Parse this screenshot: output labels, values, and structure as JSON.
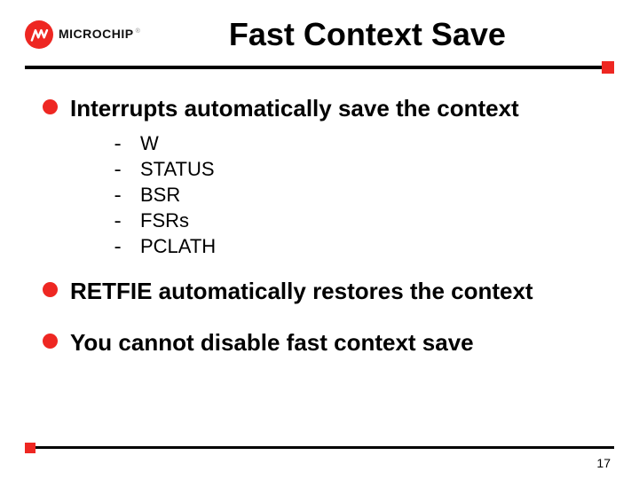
{
  "brand": {
    "name": "MICROCHIP",
    "registered": "®"
  },
  "title": "Fast Context Save",
  "bullets": [
    {
      "text": "Interrupts automatically save the context",
      "sub": [
        "W",
        "STATUS",
        "BSR",
        "FSRs",
        "PCLATH"
      ]
    },
    {
      "text": "RETFIE automatically restores the context",
      "sub": []
    },
    {
      "text": "You cannot disable fast context save",
      "sub": []
    }
  ],
  "page_number": "17"
}
